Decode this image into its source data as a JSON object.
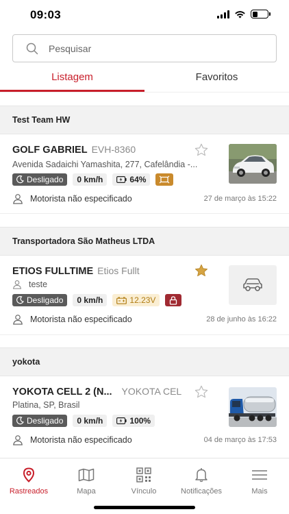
{
  "status_bar": {
    "time": "09:03"
  },
  "search": {
    "placeholder": "Pesquisar"
  },
  "tabs": [
    {
      "label": "Listagem",
      "active": true
    },
    {
      "label": "Favoritos",
      "active": false
    }
  ],
  "groups": [
    {
      "name": "Test Team HW",
      "vehicles": [
        {
          "name": "GOLF GABRIEL",
          "plate": "EVH-8360",
          "address": "Avenida Sadaichi Yamashita, 277, Cafelândia -...",
          "favorite": false,
          "status": "Desligado",
          "speed": "0 km/h",
          "battery": "64%",
          "driver": "Motorista não especificado",
          "date": "27 de março às 15:22",
          "thumbnail": "car-photo-white-hatchback"
        }
      ]
    },
    {
      "name": "Transportadora São Matheus LTDA",
      "vehicles": [
        {
          "name": "ETIOS FULLTIME",
          "plate": "Etios Fullt",
          "address": "teste",
          "favorite": true,
          "status": "Desligado",
          "speed": "0 km/h",
          "voltage": "12.23V",
          "driver": "Motorista não especificado",
          "date": "28 de junho às 16:22",
          "thumbnail": "car-placeholder-icon"
        }
      ]
    },
    {
      "name": "yokota",
      "vehicles": [
        {
          "name": "YOKOTA CELL 2 (N...",
          "plate": "YOKOTA CEL",
          "address": "Platina, SP, Brasil",
          "favorite": false,
          "status": "Desligado",
          "speed": "0 km/h",
          "battery": "100%",
          "driver": "Motorista não especificado",
          "date": "04 de março às 17:53",
          "thumbnail": "truck-photo-tanker"
        }
      ]
    }
  ],
  "bottom_nav": [
    {
      "label": "Rastreados",
      "icon": "location-pin-icon",
      "active": true
    },
    {
      "label": "Mapa",
      "icon": "map-icon",
      "active": false
    },
    {
      "label": "Vínculo",
      "icon": "qr-code-icon",
      "active": false
    },
    {
      "label": "Notificações",
      "icon": "bell-icon",
      "active": false
    },
    {
      "label": "Mais",
      "icon": "menu-icon",
      "active": false
    }
  ],
  "colors": {
    "accent": "#c81e2a",
    "badge_dark": "#5a5a5a",
    "warning": "#b07c12",
    "lock": "#a02a32"
  }
}
